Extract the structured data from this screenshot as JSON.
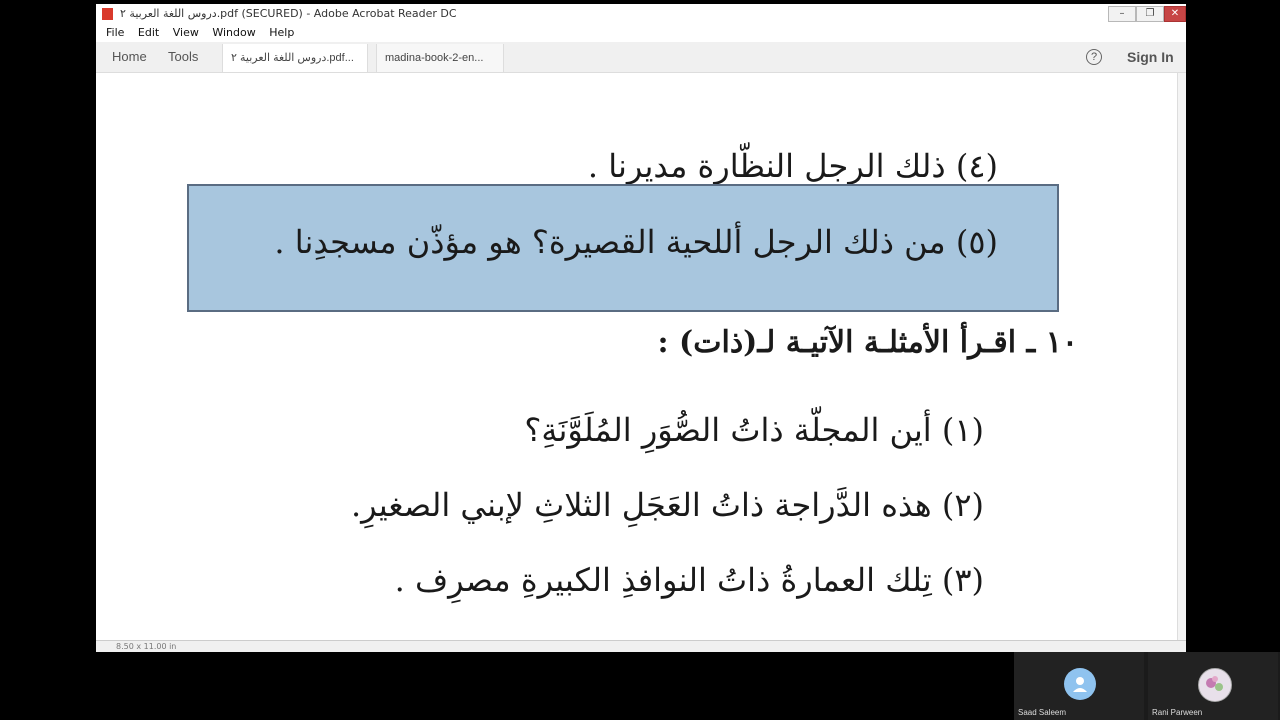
{
  "window": {
    "title": "دروس اللغة العربية ٢.pdf (SECURED) - Adobe Acrobat Reader DC",
    "controls": [
      "–",
      "❐",
      "✕"
    ]
  },
  "menu": [
    "File",
    "Edit",
    "View",
    "Window",
    "Help"
  ],
  "tabs": {
    "home": "Home",
    "tools": "Tools",
    "docs": [
      {
        "label": "دروس اللغة العربية ٢.pdf...",
        "close": "×"
      },
      {
        "label": "madina-book-2-en..."
      }
    ],
    "help": "?",
    "sign_in": "Sign In"
  },
  "document": {
    "line4": "(٤) ذلك الرجل          النظّارة مديرنا .",
    "line5": "(٥) من ذلك الرجل         أللحية القصيرة؟ هو مؤذّن مسجدِنا .",
    "exercise_heading": "١٠ ـ اقـرأ الأمثلـة الآتيـة لـ(ذات) :",
    "examples": [
      "(١) أين المجلّة ذاتُ الصُّوَرِ المُلَوَّنَةِ؟",
      "(٢) هذه الدَّراجة ذاتُ العَجَلِ الثلاثِ لإبني الصغيرِ.",
      "(٣) تِلك العمارةُ ذاتُ النوافذِ الكبيرةِ مصرِف ."
    ],
    "highlight_color": "#a8c6de"
  },
  "status": {
    "page_size": "8.50 x 11.00 in"
  },
  "participants": [
    {
      "name": "Saad Saleem"
    },
    {
      "name": "Rani Parween"
    }
  ]
}
